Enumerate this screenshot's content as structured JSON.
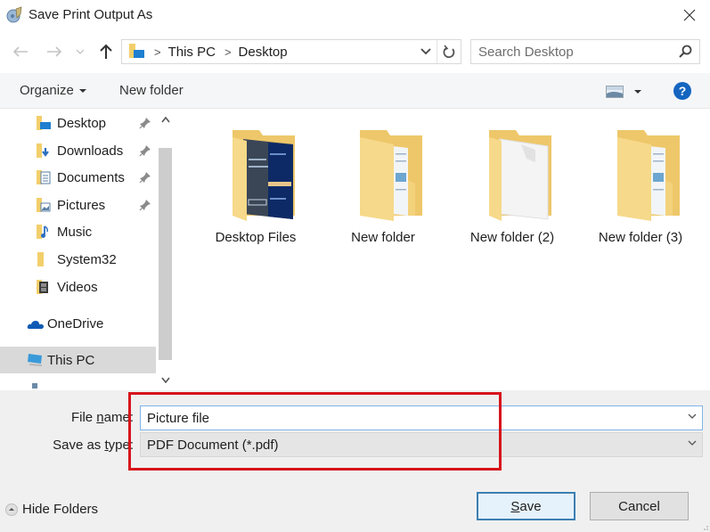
{
  "window": {
    "title": "Save Print Output As",
    "close_icon": "close-icon"
  },
  "navigation": {
    "back_icon": "arrow-left-icon",
    "forward_icon": "arrow-right-icon",
    "recent_icon": "chevron-down-icon",
    "up_icon": "arrow-up-icon",
    "breadcrumb": [
      "This PC",
      "Desktop"
    ],
    "refresh_icon": "refresh-icon",
    "search_placeholder": "Search Desktop"
  },
  "toolbar": {
    "organize_label": "Organize",
    "new_folder_label": "New folder",
    "help_label": "?"
  },
  "sidebar": {
    "items": [
      {
        "label": "Desktop",
        "icon": "desktop-folder-icon",
        "pinned": true
      },
      {
        "label": "Downloads",
        "icon": "downloads-folder-icon",
        "pinned": true
      },
      {
        "label": "Documents",
        "icon": "documents-folder-icon",
        "pinned": true
      },
      {
        "label": "Pictures",
        "icon": "pictures-folder-icon",
        "pinned": true
      },
      {
        "label": "Music",
        "icon": "music-folder-icon",
        "pinned": false
      },
      {
        "label": "System32",
        "icon": "folder-icon",
        "pinned": false
      },
      {
        "label": "Videos",
        "icon": "videos-folder-icon",
        "pinned": false
      },
      {
        "label": "OneDrive",
        "icon": "onedrive-icon",
        "pinned": false
      },
      {
        "label": "This PC",
        "icon": "this-pc-icon",
        "pinned": false,
        "selected": true
      }
    ]
  },
  "files": [
    {
      "name": "Desktop Files"
    },
    {
      "name": "New folder"
    },
    {
      "name": "New folder (2)"
    },
    {
      "name": "New folder (3)"
    }
  ],
  "form": {
    "file_name_label_pre": "File ",
    "file_name_label_u": "n",
    "file_name_label_post": "ame:",
    "file_name_value": "Picture file",
    "save_type_label_pre": "Save as ",
    "save_type_label_u": "t",
    "save_type_label_post": "ype:",
    "save_type_value": "PDF Document (*.pdf)"
  },
  "footer": {
    "hide_folders_label": "Hide Folders",
    "save_label_u": "S",
    "save_label_rest": "ave",
    "cancel_label": "Cancel"
  },
  "colors": {
    "highlight": "#d7141c",
    "accent": "#1565c0",
    "folder": "#f3cf6b"
  }
}
